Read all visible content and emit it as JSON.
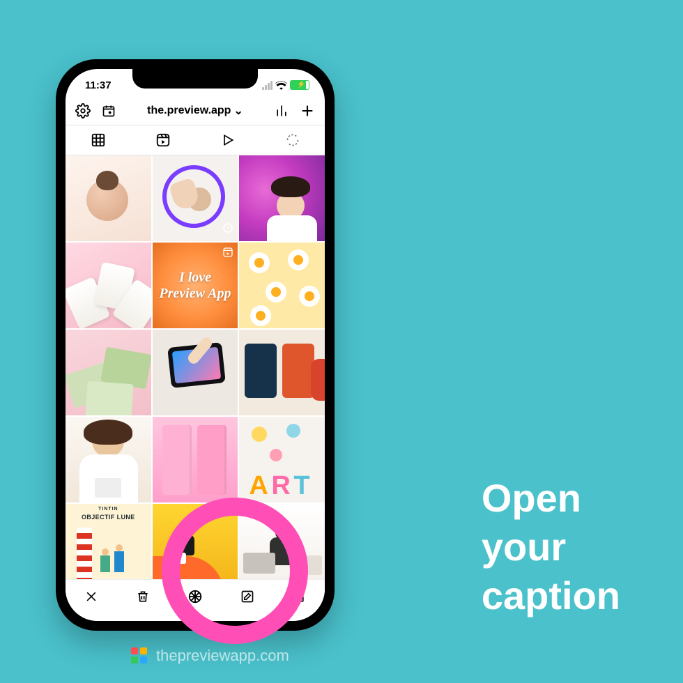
{
  "background_color": "#4ac1cb",
  "highlight_color": "#ff4fb7",
  "status": {
    "time": "11:37"
  },
  "header": {
    "account_label": "the.preview.app",
    "dropdown_glyph": "⌄"
  },
  "tabs": [
    {
      "name": "grid"
    },
    {
      "name": "reels"
    },
    {
      "name": "video"
    },
    {
      "name": "refresh"
    }
  ],
  "tiles": {
    "ilove_text": "I love Preview App",
    "objectif_lune": "OBJECTIF LUNE",
    "tintin": "TINTIN"
  },
  "actions": [
    {
      "name": "close"
    },
    {
      "name": "delete"
    },
    {
      "name": "filter"
    },
    {
      "name": "edit"
    },
    {
      "name": "share"
    }
  ],
  "caption": {
    "line1": "Open",
    "line2": "your",
    "line3": "caption"
  },
  "watermark": {
    "text": "thepreviewapp.com"
  }
}
